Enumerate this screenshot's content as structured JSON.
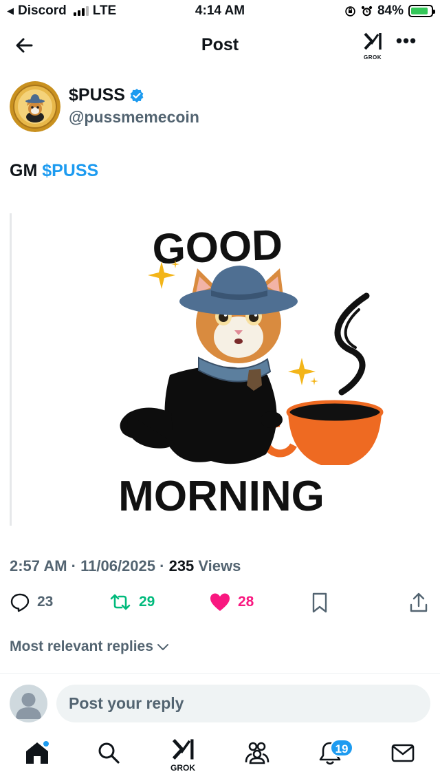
{
  "status_bar": {
    "back_app": "Discord",
    "network": "LTE",
    "time": "4:14 AM",
    "battery": "84%",
    "battery_level": 0.84
  },
  "header": {
    "title": "Post",
    "grok_label": "GROK",
    "more_label": "•••"
  },
  "author": {
    "name": "$PUSS",
    "handle": "@pussmemecoin",
    "verified": true
  },
  "tweet": {
    "text_prefix": "GM ",
    "cashtag": "$PUSS",
    "image_text_top": "GOOD",
    "image_text_bottom": "MORNING"
  },
  "meta": {
    "time": "2:57 AM",
    "sep1": " · ",
    "date": "11/06/2025",
    "sep2": " · ",
    "views_count": "235",
    "views_label": " Views"
  },
  "actions": {
    "replies": "23",
    "reposts": "29",
    "likes": "28"
  },
  "replies": {
    "sort_label": "Most relevant replies"
  },
  "composer": {
    "placeholder": "Post your reply"
  },
  "tabbar": {
    "grok_label": "GROK",
    "notifications_badge": "19"
  },
  "colors": {
    "accent": "#1d9bf0",
    "retweet": "#00ba7c",
    "like": "#f91880",
    "secondary_text": "#536471"
  }
}
